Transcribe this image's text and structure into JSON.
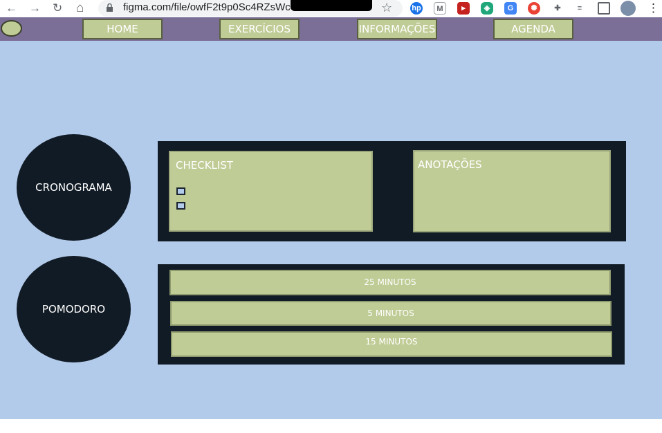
{
  "browser": {
    "back_icon": "←",
    "forward_icon": "→",
    "reload_icon": "↻",
    "home_icon": "⌂",
    "url": "figma.com/file/owfF2t9p0Sc4RZsWc4",
    "star_icon": "☆",
    "menu_icon": "⋮"
  },
  "nav": {
    "items": [
      "HOME",
      "EXERCÍCIOS",
      "INFORMAÇÕES",
      "AGENDA"
    ]
  },
  "sections": {
    "cronograma": "CRONOGRAMA",
    "pomodoro": "POMODORO"
  },
  "cards": {
    "checklist_title": "CHECKLIST",
    "anotacoes_title": "ANOTAÇÕES"
  },
  "timers": [
    "25 MINUTOS",
    "5 MINUTOS",
    "15 MINUTOS"
  ],
  "colors": {
    "background": "#b3cbeb",
    "nav_bar": "#7b6f98",
    "button_green": "#bfcc96",
    "dark_navy": "#111b25"
  }
}
